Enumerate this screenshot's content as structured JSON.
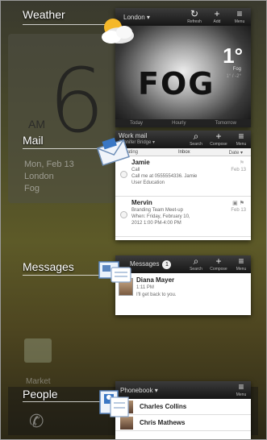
{
  "background": {
    "clock_digit": "6",
    "am": "AM",
    "date_line": "Mon, Feb 13",
    "city": "London",
    "condition": "Fog",
    "market_label": "Market"
  },
  "sections": {
    "weather": "Weather",
    "mail": "Mail",
    "messages": "Messages",
    "people": "People"
  },
  "weather": {
    "location": "London",
    "refresh": "Refresh",
    "add": "Add",
    "menu": "Menu",
    "banner": "FOG",
    "temp": "1°",
    "condition": "Fog",
    "hi_lo": "1° / -2°",
    "tabs": [
      "Today",
      "Hourly",
      "Tomorrow"
    ]
  },
  "mail": {
    "account": "Work mail",
    "account_sub": "Jennifer Bridge",
    "search": "Search",
    "compose": "Compose",
    "menu": "Menu",
    "status": "Updating",
    "folder": "Inbox",
    "sort": "Date",
    "items": [
      {
        "sender": "Jamie",
        "line1": "Call",
        "line2": "Call me at 0555554336. Jamie",
        "line3": "User Education",
        "date": "Feb 13"
      },
      {
        "sender": "Mervin",
        "line1": "Branding Team Meet-up",
        "line2": "When: Friday, February 10,",
        "line3": "2012 1:00 PM-4:00 PM",
        "date": "Feb 13"
      }
    ]
  },
  "messages": {
    "title": "Messages",
    "badge": "1",
    "search": "Search",
    "compose": "Compose",
    "menu": "Menu",
    "item": {
      "name": "Diana Mayer",
      "time": "1:11 PM",
      "text": "I'll get back to you."
    }
  },
  "people": {
    "title": "Phonebook",
    "menu": "Menu",
    "contacts": [
      "Charles Collins",
      "Chris Mathews"
    ]
  }
}
